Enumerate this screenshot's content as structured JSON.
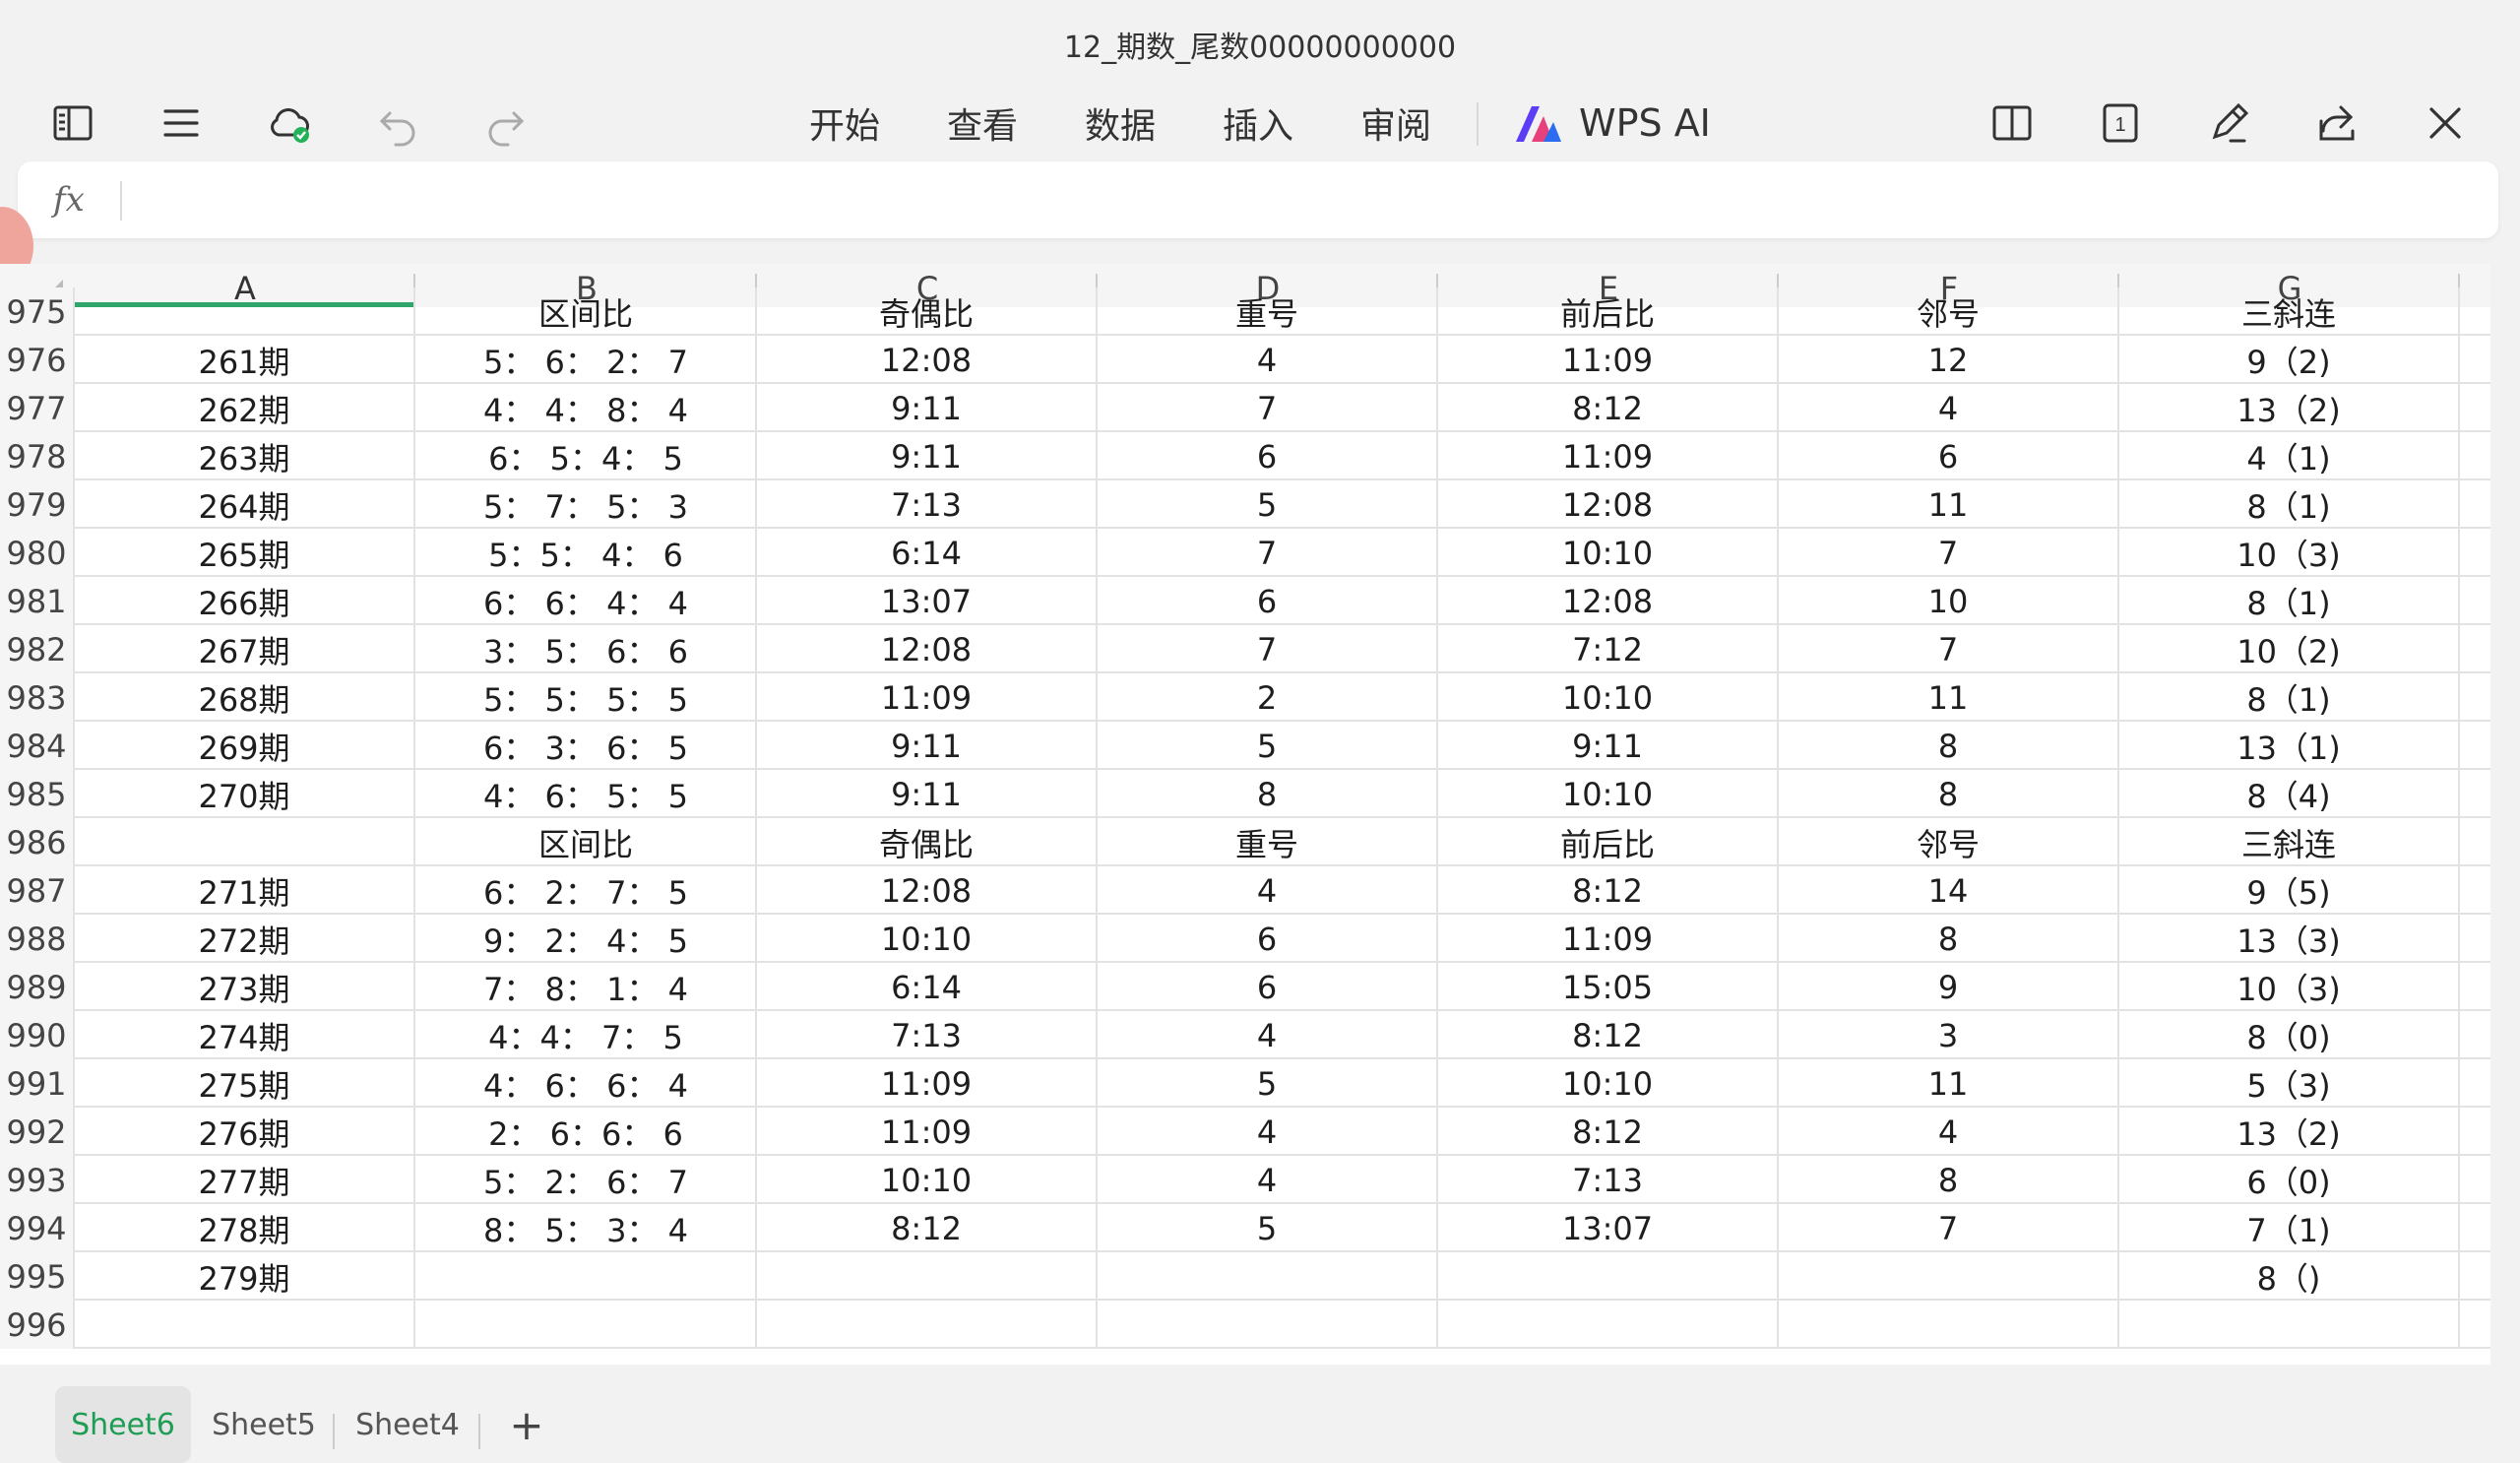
{
  "title": "12_期数_尾数00000000000",
  "toolbar": {
    "menus": [
      "开始",
      "查看",
      "数据",
      "插入",
      "审阅"
    ],
    "ai_label": "WPS AI",
    "page_count": "1"
  },
  "formula": {
    "fx_label": "fx",
    "value": ""
  },
  "columns": [
    "A",
    "B",
    "C",
    "D",
    "E",
    "F",
    "G"
  ],
  "active_column": "A",
  "rows": [
    {
      "n": "975",
      "cells": [
        "",
        "区间比",
        "奇偶比",
        "重号",
        "前后比",
        "邻号",
        "三斜连"
      ]
    },
    {
      "n": "976",
      "cells": [
        "261期",
        "5： 6： 2： 7",
        "12:08",
        "4",
        "11:09",
        "12",
        "9（2)"
      ]
    },
    {
      "n": "977",
      "cells": [
        "262期",
        "4： 4： 8： 4",
        "9:11",
        "7",
        "8:12",
        "4",
        "13（2)"
      ]
    },
    {
      "n": "978",
      "cells": [
        "263期",
        "6： 5：4： 5",
        "9:11",
        "6",
        "11:09",
        "6",
        "4（1)"
      ]
    },
    {
      "n": "979",
      "cells": [
        "264期",
        "5： 7： 5： 3",
        "7:13",
        "5",
        "12:08",
        "11",
        "8（1)"
      ]
    },
    {
      "n": "980",
      "cells": [
        "265期",
        "5：5： 4： 6",
        "6:14",
        "7",
        "10:10",
        "7",
        "10（3)"
      ]
    },
    {
      "n": "981",
      "cells": [
        "266期",
        "6： 6： 4： 4",
        "13:07",
        "6",
        "12:08",
        "10",
        "8（1)"
      ]
    },
    {
      "n": "982",
      "cells": [
        "267期",
        "3： 5： 6： 6",
        "12:08",
        "7",
        "7:12",
        "7",
        "10（2)"
      ]
    },
    {
      "n": "983",
      "cells": [
        "268期",
        "5： 5： 5： 5",
        "11:09",
        "2",
        "10:10",
        "11",
        "8（1)"
      ]
    },
    {
      "n": "984",
      "cells": [
        "269期",
        "6： 3： 6： 5",
        "9:11",
        "5",
        "9:11",
        "8",
        "13（1)"
      ]
    },
    {
      "n": "985",
      "cells": [
        "270期",
        "4： 6： 5： 5",
        "9:11",
        "8",
        "10:10",
        "8",
        "8（4)"
      ]
    },
    {
      "n": "986",
      "cells": [
        "",
        "区间比",
        "奇偶比",
        "重号",
        "前后比",
        "邻号",
        "三斜连"
      ]
    },
    {
      "n": "987",
      "cells": [
        "271期",
        "6： 2： 7： 5",
        "12:08",
        "4",
        "8:12",
        "14",
        "9（5)"
      ]
    },
    {
      "n": "988",
      "cells": [
        "272期",
        "9： 2： 4： 5",
        "10:10",
        "6",
        "11:09",
        "8",
        "13（3)"
      ]
    },
    {
      "n": "989",
      "cells": [
        "273期",
        "7： 8： 1： 4",
        "6:14",
        "6",
        "15:05",
        "9",
        "10（3)"
      ]
    },
    {
      "n": "990",
      "cells": [
        "274期",
        "4：4： 7： 5",
        "7:13",
        "4",
        "8:12",
        "3",
        "8（0)"
      ]
    },
    {
      "n": "991",
      "cells": [
        "275期",
        "4： 6： 6： 4",
        "11:09",
        "5",
        "10:10",
        "11",
        "5（3)"
      ]
    },
    {
      "n": "992",
      "cells": [
        "276期",
        "2： 6：6： 6",
        "11:09",
        "4",
        "8:12",
        "4",
        "13（2)"
      ]
    },
    {
      "n": "993",
      "cells": [
        "277期",
        "5： 2： 6： 7",
        "10:10",
        "4",
        "7:13",
        "8",
        "6（0)"
      ]
    },
    {
      "n": "994",
      "cells": [
        "278期",
        "8： 5： 3： 4",
        "8:12",
        "5",
        "13:07",
        "7",
        "7（1)"
      ]
    },
    {
      "n": "995",
      "cells": [
        "279期",
        "",
        "",
        "",
        "",
        "",
        "8（)"
      ]
    },
    {
      "n": "996",
      "cells": [
        "",
        "",
        "",
        "",
        "",
        "",
        ""
      ]
    }
  ],
  "sheets": [
    "Sheet6",
    "Sheet5",
    "Sheet4"
  ],
  "active_sheet": "Sheet6",
  "add_sheet_label": "+",
  "colors": {
    "accent": "#1f9d55",
    "grid": "#e2e2e2",
    "header_bg": "#f5f5f5"
  }
}
